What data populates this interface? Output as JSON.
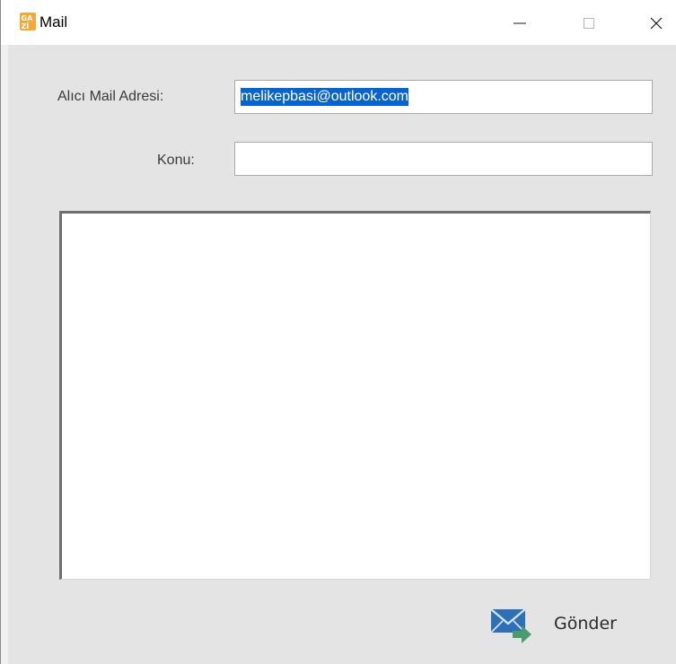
{
  "window": {
    "title": "Mail",
    "app_icon": "gazi-logo-icon",
    "controls": [
      "minimize-icon",
      "maximize-icon",
      "close-icon"
    ]
  },
  "form": {
    "to_label": "Alıcı Mail Adresi:",
    "to_value": "melikepbasi@outlook.com",
    "subject_label": "Konu:",
    "subject_value": "",
    "body_value": ""
  },
  "actions": {
    "send_label": "Gönder",
    "send_icon": "mail-send-icon"
  },
  "colors": {
    "window_bg": "#e4e4e4",
    "selection": "#0a64c8",
    "icon_blue": "#2f6fb7",
    "arrow_green": "#4a9c6d"
  }
}
